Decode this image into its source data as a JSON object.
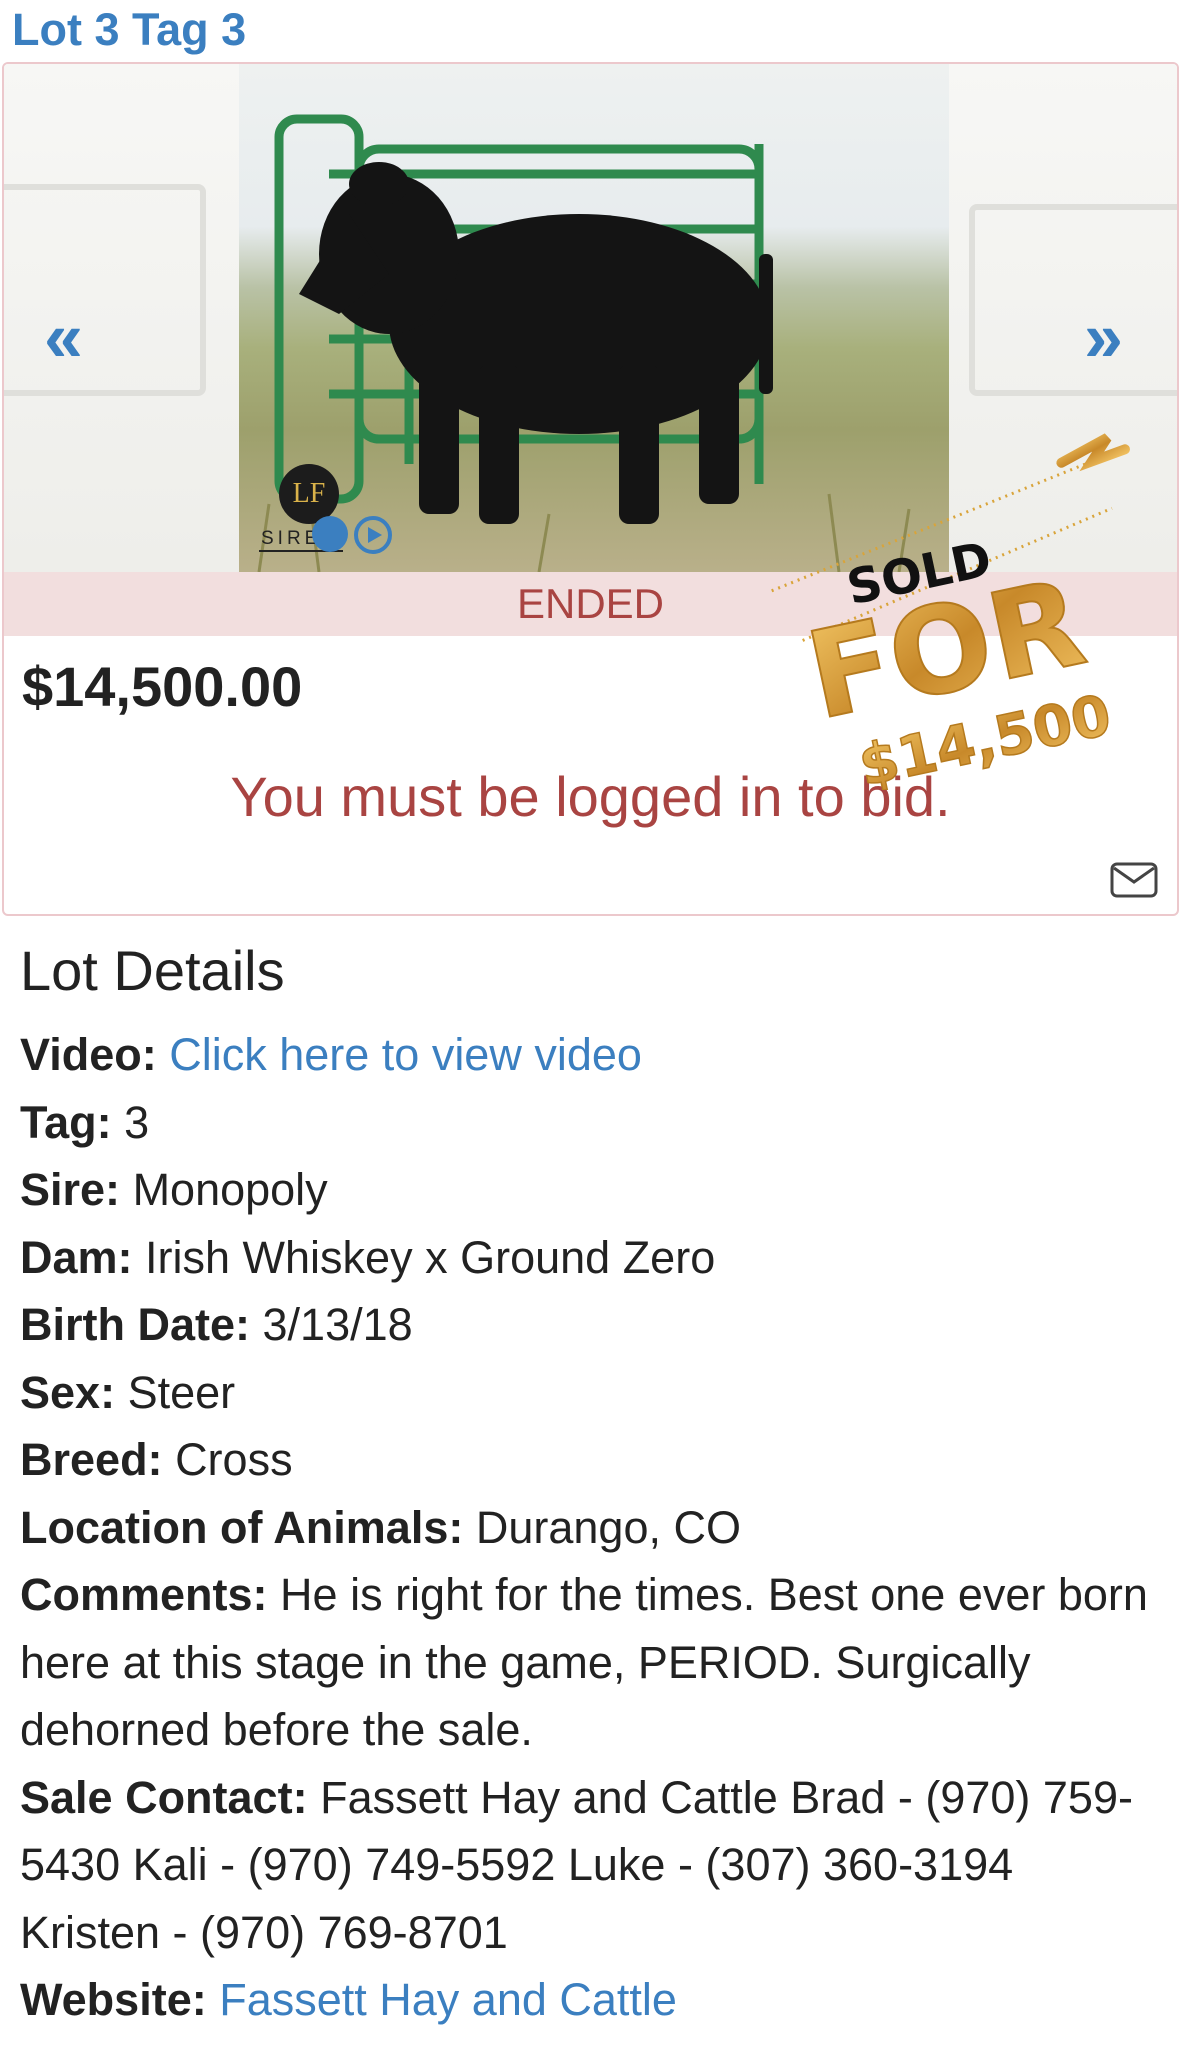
{
  "header": {
    "title": "Lot 3 Tag 3"
  },
  "carousel": {
    "prev_label": "«",
    "next_label": "»",
    "logo": {
      "initials": "LF",
      "caption": "SIRED"
    },
    "slide_count": 2,
    "active_slide": 1
  },
  "status": {
    "label": "ENDED"
  },
  "price": {
    "amount": "$14,500.00"
  },
  "bid": {
    "message": "You must be logged in to bid."
  },
  "badge": {
    "line1": "SOLD",
    "line2": "FOR",
    "line3": "$14,500"
  },
  "details": {
    "heading": "Lot Details",
    "video": {
      "label": "Video:",
      "value": "Click here to view video"
    },
    "tag": {
      "label": "Tag:",
      "value": "3"
    },
    "sire": {
      "label": "Sire:",
      "value": "Monopoly"
    },
    "dam": {
      "label": "Dam:",
      "value": "Irish Whiskey x Ground Zero"
    },
    "birth_date": {
      "label": "Birth Date:",
      "value": "3/13/18"
    },
    "sex": {
      "label": "Sex:",
      "value": "Steer"
    },
    "breed": {
      "label": "Breed:",
      "value": "Cross"
    },
    "location": {
      "label": "Location of Animals:",
      "value": "Durango, CO"
    },
    "comments": {
      "label": "Comments:",
      "value": "He is right for the times. Best one ever born here at this stage in the game, PERIOD. Surgically dehorned before the sale."
    },
    "sale_contact": {
      "label": "Sale Contact:",
      "value": "Fassett Hay and Cattle Brad - (970) 759-5430 Kali - (970) 749-5592 Luke - (307) 360-3194 Kristen - (970) 769-8701"
    },
    "website": {
      "label": "Website:",
      "value": "Fassett Hay and Cattle"
    }
  },
  "colors": {
    "link": "#3b7fc0",
    "alert": "#a94442",
    "status_bg": "#f2dede",
    "badge_gold": "#d9a43a"
  },
  "icons": {
    "mail": "envelope-icon",
    "play": "play-icon"
  }
}
